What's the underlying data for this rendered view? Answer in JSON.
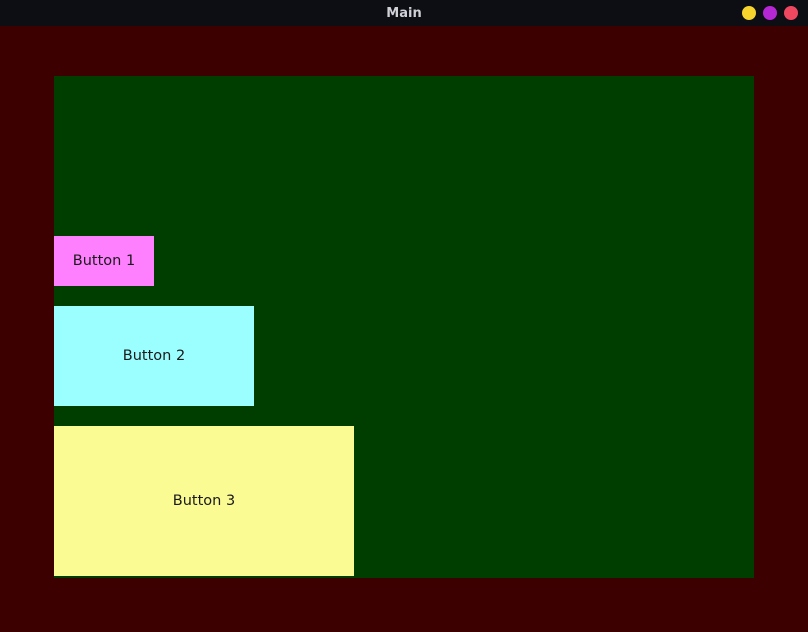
{
  "window": {
    "title": "Main",
    "controls": {
      "minimize": "minimize",
      "maximize": "maximize",
      "close": "close"
    }
  },
  "buttons": {
    "b1": {
      "label": "Button 1"
    },
    "b2": {
      "label": "Button 2"
    },
    "b3": {
      "label": "Button 3"
    }
  },
  "colors": {
    "outer": "#3d0000",
    "panel": "#003e00",
    "b1": "#ff80ff",
    "b2": "#9bffff",
    "b3": "#fbfb93"
  }
}
